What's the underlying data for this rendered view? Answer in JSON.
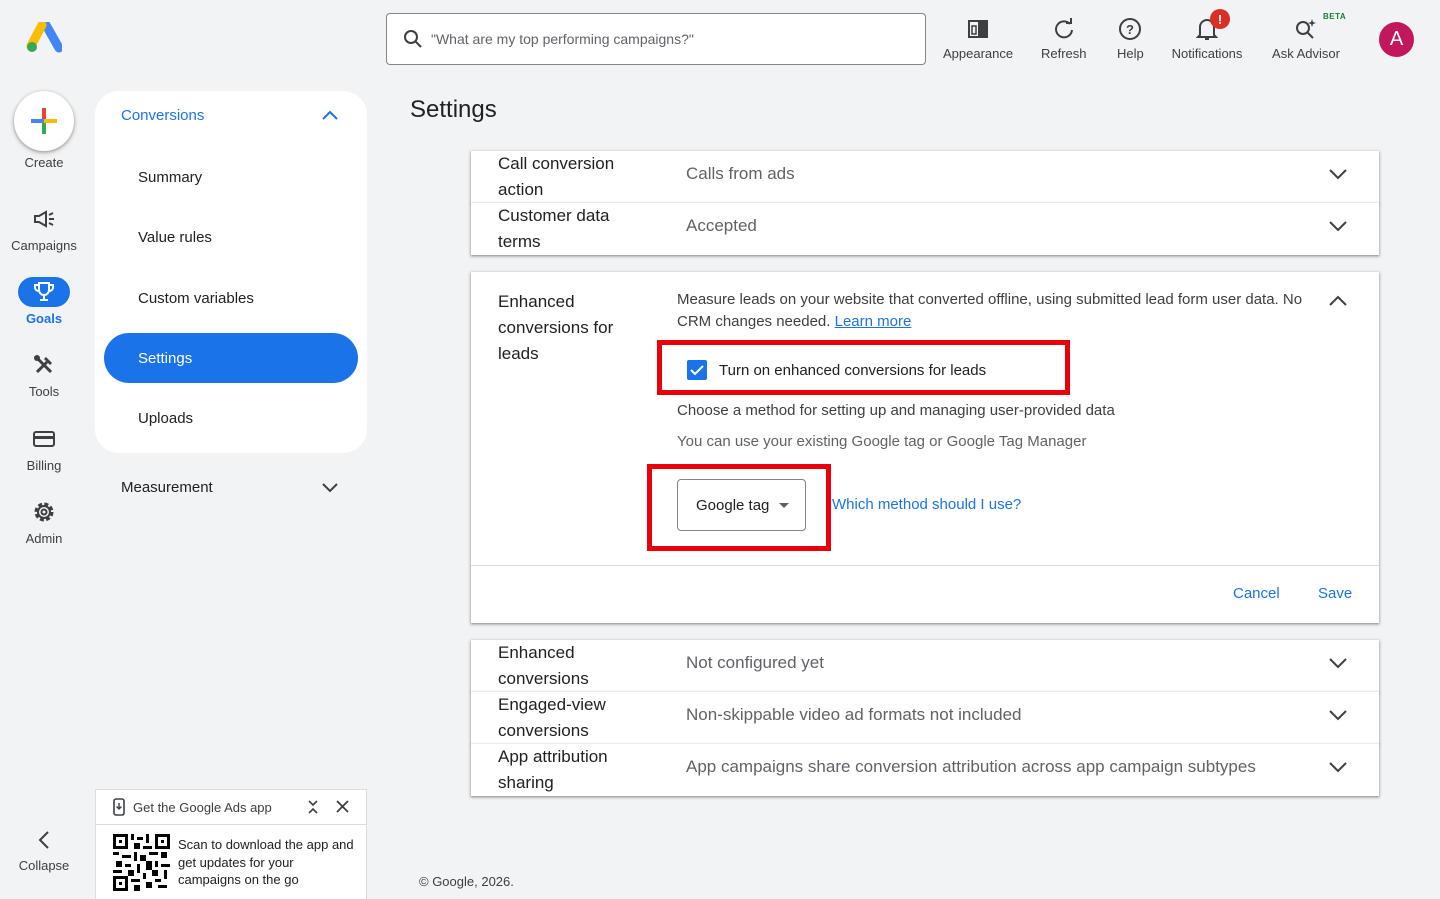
{
  "header": {
    "search_placeholder": "\"What are my top performing campaigns?\"",
    "appearance_label": "Appearance",
    "refresh_label": "Refresh",
    "help_label": "Help",
    "notifications_label": "Notifications",
    "notifications_badge": "!",
    "ask_advisor_label": "Ask Advisor",
    "ask_advisor_badge": "BETA",
    "avatar_initial": "A"
  },
  "rail": {
    "create_label": "Create",
    "items": [
      {
        "label": "Campaigns",
        "icon": "megaphone-icon"
      },
      {
        "label": "Goals",
        "icon": "trophy-icon"
      },
      {
        "label": "Tools",
        "icon": "tools-icon"
      },
      {
        "label": "Billing",
        "icon": "card-icon"
      },
      {
        "label": "Admin",
        "icon": "gear-icon"
      }
    ],
    "collapse_label": "Collapse"
  },
  "subnav": {
    "section_title": "Conversions",
    "items": [
      "Summary",
      "Value rules",
      "Custom variables",
      "Settings",
      "Uploads"
    ],
    "measurement_label": "Measurement"
  },
  "promo": {
    "title": "Get the Google Ads app",
    "text": "Scan to download the app and get updates for your campaigns on the go"
  },
  "main": {
    "title": "Settings",
    "rows_top": [
      {
        "name": "Call conversion action",
        "value": "Calls from ads"
      },
      {
        "name": "Customer data terms",
        "value": "Accepted"
      }
    ],
    "enhanced_leads": {
      "name": "Enhanced conversions for leads",
      "description": "Measure leads on your website that converted offline, using submitted lead form user data. No CRM changes needed.",
      "learn_more": "Learn more",
      "checkbox_label": "Turn on enhanced conversions for leads",
      "checkbox_checked": true,
      "method_heading": "Choose a method for setting up and managing user-provided data",
      "method_hint": "You can use your existing Google tag or Google Tag Manager",
      "dropdown_value": "Google tag",
      "which_method_link": "Which method should I use?",
      "cancel_label": "Cancel",
      "save_label": "Save"
    },
    "rows_bottom": [
      {
        "name": "Enhanced conversions",
        "value": "Not configured yet"
      },
      {
        "name": "Engaged-view conversions",
        "value": "Non-skippable video ad formats not included"
      },
      {
        "name": "App attribution sharing",
        "value": "App campaigns share conversion attribution across app campaign subtypes"
      }
    ]
  },
  "footer": {
    "copyright": "© Google, 2026."
  },
  "colors": {
    "accent": "#1a73e8",
    "highlight": "#e8000b",
    "avatar": "#c2185b"
  }
}
